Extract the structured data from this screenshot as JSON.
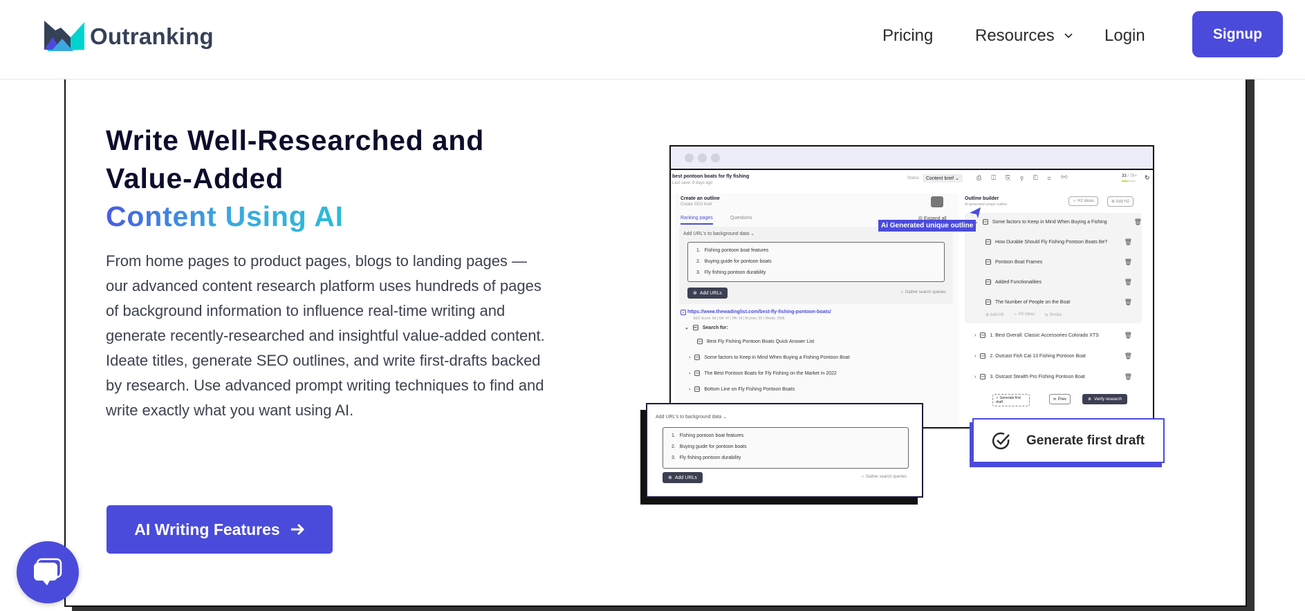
{
  "header": {
    "logo_text": "Outranking",
    "nav": {
      "pricing": "Pricing",
      "resources": "Resources",
      "login": "Login"
    },
    "signup_label": "Signup"
  },
  "hero": {
    "title_line1": "Write Well-Researched and",
    "title_line2": "Value-Added",
    "title_line3": "Content Using AI",
    "paragraph": "From home pages to product pages, blogs to landing pages — our advanced content research platform uses hundreds of pages of background information to influence real-time writing and generate recently-researched and insightful value-added content. Ideate titles, generate SEO outlines, and write first-drafts backed by research. Use advanced prompt writing techniques to find and write exactly what you want using AI.",
    "cta_label": "AI Writing Features",
    "cta_icon": "arrow-right-icon"
  },
  "mockup": {
    "doc_title": "best pontoon boats for fly fishing",
    "last_save": "Last save: 6 days ago",
    "status_label": "Status",
    "status_value": "Content brief",
    "score": "33",
    "score_target": "/ 78+",
    "left_pane": {
      "title": "Create an outline",
      "subtitle": "Create SEO brief",
      "tabs": [
        "Ranking pages",
        "Questions"
      ],
      "expand_all": "Expand all",
      "add_urls_dropdown": "Add URL's to background data",
      "queries": [
        "Fishing pontoon boat features",
        "Buying guide for pontoon boats",
        "Fly fishing pontoon durability"
      ],
      "add_urls_button": "Add URLs",
      "gather_queries": "Gather search queries",
      "result_url": "https://www.thewadinglist.com/best-fly-fishing-pontoon-boats/",
      "result_meta": "SEO Score: 68 | DA: 47 | PA: 10 | B.Links: 20 | Words: 2936",
      "search_for": "Search for:",
      "headings": [
        "Best Fly Fishing Pontoon Boats Quick Answer List",
        "Some factors to Keep in Mind When Buying a Fishing Pontoon Boat",
        "The Best Pontoon Boats for Fly Fishing on the Market in 2022",
        "Bottom Line on Fly Fishing Pontoon Boats"
      ]
    },
    "right_pane": {
      "title": "Outline builder",
      "subtitle": "AI generated unique outline",
      "h2_ideas": "H2 ideas",
      "add_h2": "Add H2",
      "h2_main": "Some factors to Keep in Mind When Buying a Fishing",
      "h3_items": [
        "How Durable Should Fly Fishing Pontoon Boats Be?",
        "Pontoon Boat Frames",
        "Added Functionalities",
        "The Number of People on the Boat"
      ],
      "add_h3": "Add H3",
      "h3_ideas": "H3 Ideas",
      "similar": "Similar",
      "h2_items": [
        "1. Best Overall: Classic Accessories Colorado XTS",
        "2. Outcast Fish Cat 13 Fishing Pontoon Boat",
        "3. Outcast Stealth Pro Fishing Pontoon Boat"
      ],
      "generate_small": "Generate first draft",
      "prev": "Prev",
      "verify": "Verify research"
    },
    "ai_tag": "Ai Generated unique outline",
    "popup_generate": "Generate first draft"
  },
  "colors": {
    "brand": "#4a4bdb",
    "heading": "#0b0d2b",
    "dark_button": "#3c3f52"
  }
}
